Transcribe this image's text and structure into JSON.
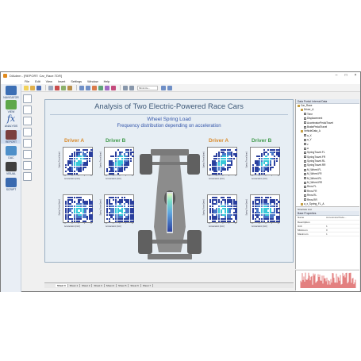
{
  "window": {
    "title": "DIAdem - [REPORT: Car_Race.TDR]"
  },
  "menu": [
    "File",
    "Edit",
    "View",
    "Insert",
    "Settings",
    "Window",
    "Help"
  ],
  "toolbar": {
    "combo_label": "Minimize..."
  },
  "nav": {
    "items": [
      {
        "label": "NAVIGATOR"
      },
      {
        "label": "VIEW"
      },
      {
        "label": "ANALYSIS"
      },
      {
        "label": "REPORT"
      },
      {
        "label": "DAC"
      },
      {
        "label": "VISUAL"
      },
      {
        "label": "SCRIPT"
      }
    ]
  },
  "report": {
    "title": "Analysis of Two Electric-Powered Race Cars",
    "subtitle": "Wheel Spring Load",
    "subtitle2": "Frequency distribution depending on acceleration",
    "driver_a": "Driver A",
    "driver_b": "Driver B",
    "plot_ylabel": "Spring Travel [mm]",
    "plot_xlabel": "Acceleration [m/s²]",
    "plot_ticks": [
      "-10",
      "-5",
      "0",
      "5",
      "10"
    ]
  },
  "colors": {
    "accent": "#3d5877",
    "driver_a": "#d98a2a",
    "driver_b": "#3f9a4a",
    "heat_low": "#2a3f9e",
    "heat_high": "#38c8d8"
  },
  "data_portal": {
    "title": "Data Portal: Internal Data",
    "tree": [
      "Car_Race",
      "Driver_A",
      "Time",
      "Displacement",
      "AcceleratorPedalTravel",
      "BrakePedalTravel",
      "VehicleData_A",
      "a_X",
      "a_Y",
      "v",
      "a",
      "SpringTravel.FL",
      "SpringTravel.FR",
      "SpringTravel.RL",
      "SpringTravel.RR",
      "M_Wheel.FL",
      "M_Wheel.FR",
      "M_Wheel.RL",
      "M_Wheel.RR",
      "Revs.FL",
      "Revs.FR",
      "Revs.RL",
      "Revs.RR",
      "a_x_Spring_FL_A"
    ],
    "tabs": "Structure  List"
  },
  "properties": {
    "title": "Base Properties",
    "rows": [
      {
        "k": "Name",
        "v": "AcceleratorPeda..."
      },
      {
        "k": "Description",
        "v": ""
      },
      {
        "k": "Unit",
        "v": "1"
      },
      {
        "k": "Minimum",
        "v": "0"
      },
      {
        "k": "Maximum",
        "v": "1"
      }
    ]
  },
  "sheet_tabs": [
    "Sheet 0",
    "Sheet 1",
    "Sheet 2",
    "Sheet 3",
    "Sheet 4",
    "Sheet 5",
    "Sheet 6",
    "Sheet 7"
  ]
}
